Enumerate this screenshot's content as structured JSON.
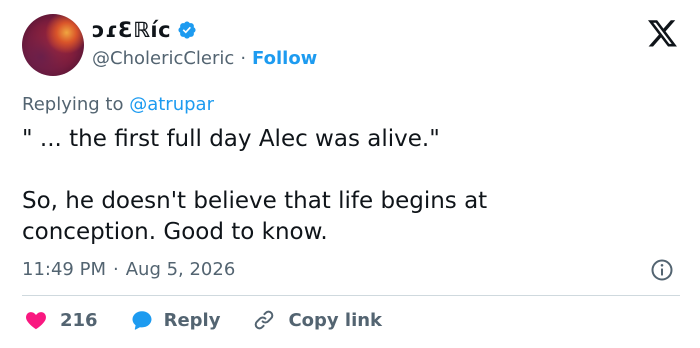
{
  "author": {
    "display_name": "ɔɾƐℝíc",
    "handle": "@CholericCleric",
    "separator": "·",
    "follow_label": "Follow"
  },
  "reply_context": {
    "prefix": "Replying to",
    "mention": "@atrupar"
  },
  "tweet": {
    "line1": "\" ... the first full day Alec was alive.\"",
    "line2": "So, he doesn't believe that life begins at\nconception. Good to know."
  },
  "meta": {
    "time": "11:49 PM",
    "separator": "·",
    "date": "Aug 5, 2026"
  },
  "actions": {
    "like_count": "216",
    "reply_label": "Reply",
    "copy_label": "Copy link"
  },
  "colors": {
    "accent": "#1d9bf0",
    "like": "#f91880",
    "muted": "#536471",
    "text": "#0f1419"
  },
  "icons": [
    "verified-badge-icon",
    "x-logo-icon",
    "info-icon",
    "heart-icon",
    "reply-bubble-icon",
    "link-icon"
  ]
}
